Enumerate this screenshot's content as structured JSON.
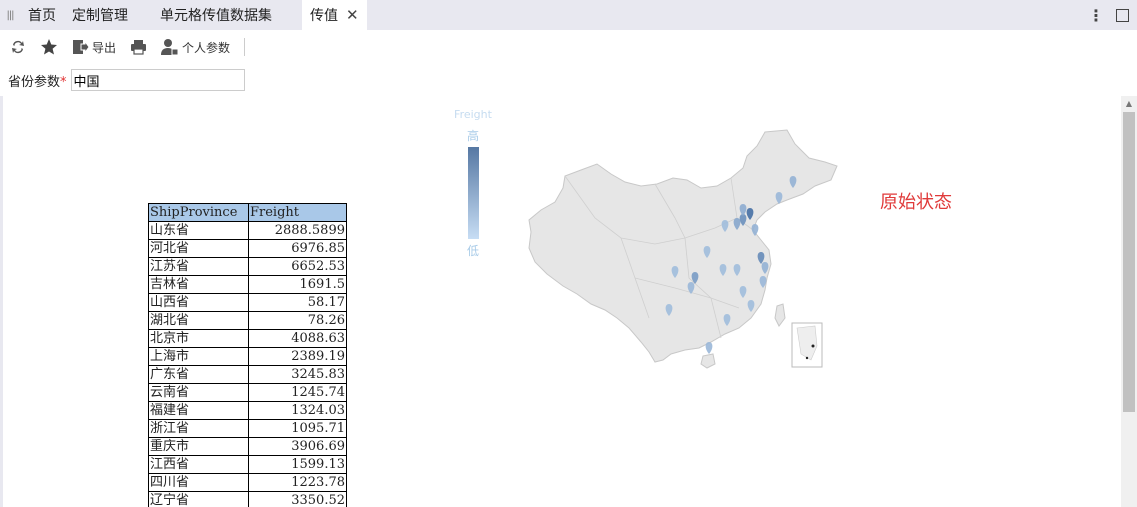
{
  "tabs": {
    "home": "首页",
    "custom": "定制管理",
    "cell": "单元格传值数据集",
    "active": "传值",
    "close_glyph": "✕"
  },
  "toolbar": {
    "refresh_icon": "refresh-icon",
    "favorite_icon": "star-icon",
    "export_label": "导出",
    "print_icon": "print-icon",
    "personal_label": "个人参数"
  },
  "param": {
    "label": "省份参数",
    "required": "*",
    "value": "中国"
  },
  "table": {
    "headers": [
      "ShipProvince",
      "Freight"
    ],
    "rows": [
      [
        "山东省",
        "2888.5899"
      ],
      [
        "河北省",
        "6976.85"
      ],
      [
        "江苏省",
        "6652.53"
      ],
      [
        "吉林省",
        "1691.5"
      ],
      [
        "山西省",
        "58.17"
      ],
      [
        "湖北省",
        "78.26"
      ],
      [
        "北京市",
        "4088.63"
      ],
      [
        "上海市",
        "2389.19"
      ],
      [
        "广东省",
        "3245.83"
      ],
      [
        "云南省",
        "1245.74"
      ],
      [
        "福建省",
        "1324.03"
      ],
      [
        "浙江省",
        "1095.71"
      ],
      [
        "重庆市",
        "3906.69"
      ],
      [
        "江西省",
        "1599.13"
      ],
      [
        "四川省",
        "1223.78"
      ],
      [
        "辽宁省",
        "3350.52"
      ]
    ]
  },
  "legend": {
    "title": "Freight",
    "high": "高",
    "low": "低"
  },
  "status_text": "原始状态",
  "colors": {
    "header_bg": "#a9c8e8",
    "status_red": "#e03a3a",
    "map_fill": "#e6e6e6"
  }
}
